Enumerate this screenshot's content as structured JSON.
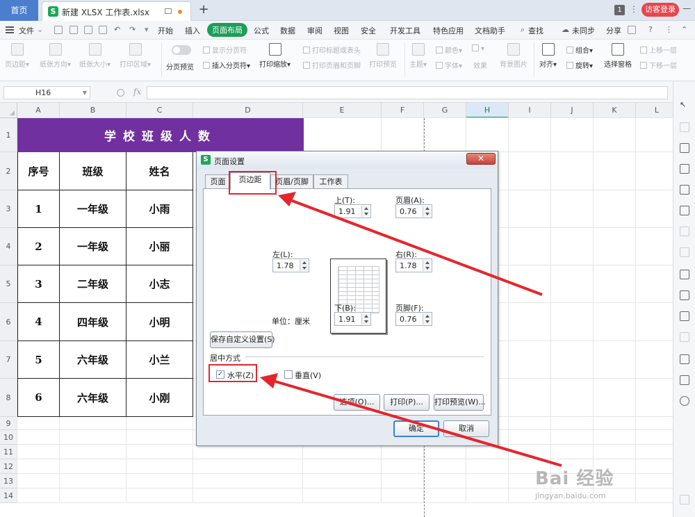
{
  "tabs": {
    "home": "首页",
    "app_badge": "S",
    "document": "新建 XLSX 工作表.xlsx",
    "new_tab": "+",
    "window_count": "1",
    "login": "访客登录"
  },
  "menu": {
    "file": "文件",
    "items": [
      "开始",
      "插入",
      "页面布局",
      "公式",
      "数据",
      "审阅",
      "视图",
      "安全",
      "开发工具",
      "特色应用",
      "文档助手"
    ],
    "active_index": 2,
    "search": "查找",
    "sync": "未同步",
    "share": "分享"
  },
  "ribbon": {
    "margins": "页边距",
    "orientation": "纸张方向",
    "size": "纸张大小",
    "print_area": "打印区域",
    "page_break_preview": "分页预览",
    "show_page_breaks": "显示分页符",
    "insert_page_break": "插入分页符",
    "print_scaling": "打印缩放",
    "print_titles": "打印标题或表头",
    "print_header_footer": "打印页眉和页脚",
    "print_preview": "打印预览",
    "theme": "主题",
    "colors": "颜色",
    "fonts": "字体",
    "effects": "效果",
    "background": "背景图片",
    "align": "对齐",
    "group": "组合",
    "rotate": "旋转",
    "selection_pane": "选择窗格",
    "bring_forward": "上移一层",
    "send_backward": "下移一层"
  },
  "formula_bar": {
    "cell_ref": "H16",
    "fx": "fx",
    "value": ""
  },
  "sheet": {
    "columns": [
      "A",
      "B",
      "C",
      "D",
      "E",
      "F",
      "G",
      "H",
      "I",
      "J",
      "K",
      "L"
    ],
    "selected_column": "H",
    "rows": [
      "1",
      "2",
      "3",
      "4",
      "5",
      "6",
      "7",
      "8",
      "9",
      "10",
      "11",
      "12",
      "13",
      "14"
    ],
    "title": "学校班级人数",
    "header": [
      "序号",
      "班级",
      "姓名"
    ],
    "data": [
      [
        "1",
        "一年级",
        "小雨"
      ],
      [
        "2",
        "一年级",
        "小丽"
      ],
      [
        "3",
        "二年级",
        "小志"
      ],
      [
        "4",
        "四年级",
        "小明"
      ],
      [
        "5",
        "六年级",
        "小兰"
      ],
      [
        "6",
        "六年级",
        "小刚"
      ]
    ],
    "title_color": "#7030a0"
  },
  "dialog": {
    "title": "页面设置",
    "logo": "S",
    "tabs": [
      "页面",
      "页边距",
      "页眉/页脚",
      "工作表"
    ],
    "active_tab": 1,
    "top_label": "上(T):",
    "top_value": "1.91",
    "header_label": "页眉(A):",
    "header_value": "0.76",
    "left_label": "左(L):",
    "left_value": "1.78",
    "right_label": "右(R):",
    "right_value": "1.78",
    "bottom_label": "下(B):",
    "bottom_value": "1.91",
    "footer_label": "页脚(F):",
    "footer_value": "0.76",
    "unit_label": "单位：厘米",
    "save_custom": "保存自定义设置(S)",
    "center_group": "居中方式",
    "horizontal": "水平(Z)",
    "horizontal_checked": true,
    "vertical": "垂直(V)",
    "vertical_checked": false,
    "options": "选项(O)...",
    "print": "打印(P)...",
    "print_preview": "打印预览(W)...",
    "ok": "确定",
    "cancel": "取消"
  },
  "annotation_color": "#e4262c",
  "watermark": {
    "logo": "Bai 经验",
    "url": "jingyan.baidu.com"
  }
}
